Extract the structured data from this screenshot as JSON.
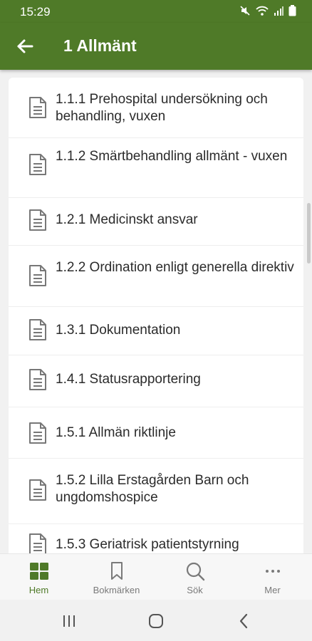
{
  "status_bar": {
    "time": "15:29",
    "icons": [
      "mute-icon",
      "wifi-icon",
      "signal-icon",
      "battery-icon"
    ]
  },
  "app_bar": {
    "title": "1 Allmänt",
    "back_icon": "arrow-left-icon"
  },
  "list": {
    "items": [
      {
        "label": "1.1.1 Prehospital undersökning och behandling, vuxen"
      },
      {
        "label": "1.1.2 Smärtbehandling allmänt - vuxen"
      },
      {
        "label": "1.2.1 Medicinskt ansvar"
      },
      {
        "label": "1.2.2 Ordination enligt generella direktiv"
      },
      {
        "label": "1.3.1 Dokumentation"
      },
      {
        "label": "1.4.1 Statusrapportering"
      },
      {
        "label": "1.5.1 Allmän riktlinje"
      },
      {
        "label": "1.5.2 Lilla Erstagården Barn och ungdomshospice"
      },
      {
        "label": "1.5.3 Geriatrisk patientstyrning"
      }
    ]
  },
  "bottom_nav": {
    "items": [
      {
        "label": "Hem",
        "icon": "grid-icon",
        "active": true
      },
      {
        "label": "Bokmärken",
        "icon": "bookmark-icon",
        "active": false
      },
      {
        "label": "Sök",
        "icon": "search-icon",
        "active": false
      },
      {
        "label": "Mer",
        "icon": "more-icon",
        "active": false
      }
    ]
  },
  "colors": {
    "primary": "#4f7a28",
    "background": "#f1f1f1",
    "card": "#ffffff",
    "nav_inactive": "#7a7a7a"
  }
}
